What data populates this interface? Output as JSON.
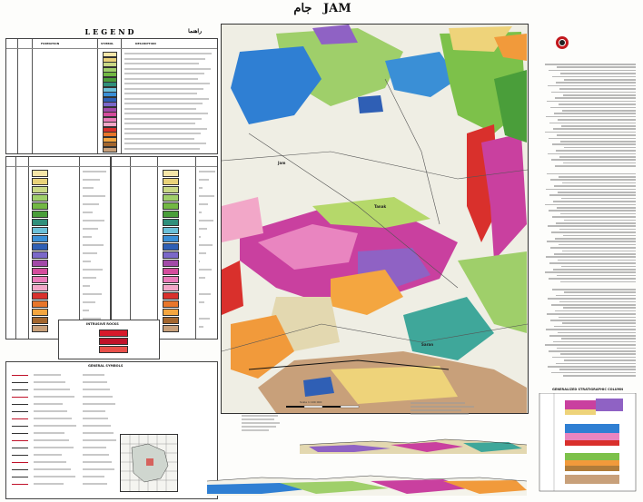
{
  "title": {
    "en": "JAM",
    "fa": "جام"
  },
  "legend": {
    "heading": "LEGEND",
    "heading_fa": "راهنما",
    "columns": [
      "FORMATION",
      "SYMBOL",
      "DESCRIPTION"
    ],
    "sections": [
      "INTRUSIVE ROCKS",
      "GENERAL SYMBOLS"
    ],
    "colors": [
      "#f5e6a8",
      "#e9d27a",
      "#c9d886",
      "#9fcf6a",
      "#72b843",
      "#4a9e3a",
      "#2f8f7b",
      "#6bc0d8",
      "#3a8fd6",
      "#2f5fb5",
      "#7b68c9",
      "#a24aa8",
      "#d44c9c",
      "#e97ab8",
      "#f2a7c8",
      "#d9302c",
      "#e8762a",
      "#f4a640",
      "#a3662e",
      "#c8a07a"
    ],
    "intrusive_colors": [
      "#d7192b",
      "#c0122a",
      "#e8504a"
    ]
  },
  "map": {
    "labels": [
      "Jam",
      "Tanak",
      "Saran"
    ],
    "colors": {
      "background": "#eeeee6",
      "alluvium": "#f4f3ea",
      "green_light": "#b5d86a",
      "green_mid": "#7dc14a",
      "blue": "#2f7fd3",
      "magenta": "#c9409f",
      "pink": "#e985c0",
      "purple": "#8f62c4",
      "orange": "#f19a3b",
      "yellow": "#eed37a",
      "red": "#d9302c",
      "brown": "#b07c3a",
      "teal": "#3fa79a"
    }
  },
  "scale": {
    "text": "Scale 1:100 000"
  },
  "strat_section": {
    "title": "GENERALIZED STRATIGRAPHIC COLUMN"
  }
}
